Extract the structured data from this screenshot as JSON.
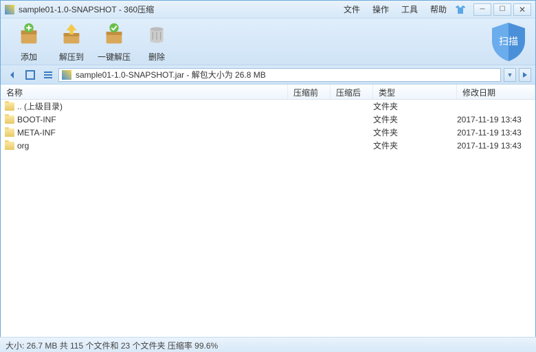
{
  "titlebar": {
    "title": "sample01-1.0-SNAPSHOT - 360压缩"
  },
  "menu": {
    "file": "文件",
    "operate": "操作",
    "tools": "工具",
    "help": "帮助"
  },
  "toolbar": {
    "add": "添加",
    "extract_to": "解压到",
    "one_click": "一键解压",
    "delete": "删除",
    "scan": "扫描"
  },
  "pathbar": {
    "text": "sample01-1.0-SNAPSHOT.jar - 解包大小为 26.8 MB"
  },
  "columns": {
    "name": "名称",
    "before": "压缩前",
    "after": "压缩后",
    "type": "类型",
    "date": "修改日期"
  },
  "rows": [
    {
      "name": ".. (上级目录)",
      "type": "文件夹",
      "date": ""
    },
    {
      "name": "BOOT-INF",
      "type": "文件夹",
      "date": "2017-11-19 13:43"
    },
    {
      "name": "META-INF",
      "type": "文件夹",
      "date": "2017-11-19 13:43"
    },
    {
      "name": "org",
      "type": "文件夹",
      "date": "2017-11-19 13:43"
    }
  ],
  "statusbar": {
    "text": "大小: 26.7 MB 共 115 个文件和 23 个文件夹 压缩率 99.6%"
  }
}
